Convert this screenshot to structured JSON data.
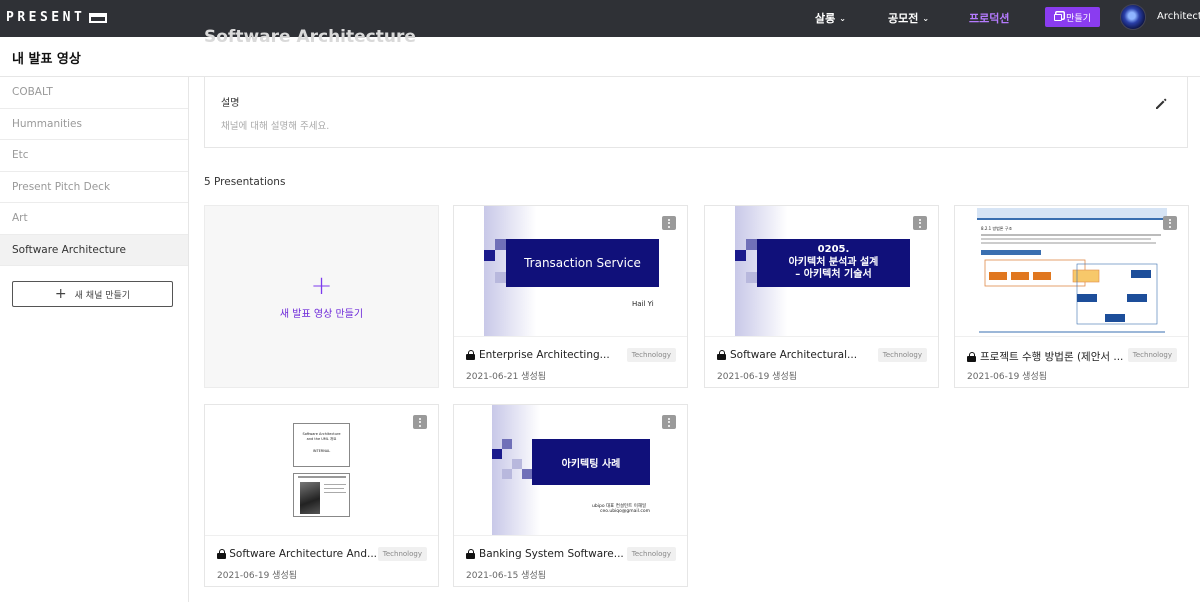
{
  "topbar": {
    "logo": "PRESENT",
    "nav": [
      {
        "label": "살롱",
        "has_menu": true
      },
      {
        "label": "공모전",
        "has_menu": true
      },
      {
        "label": "프로덕션",
        "has_menu": false,
        "active": true
      }
    ],
    "make_button": "만들기",
    "username": "Architect",
    "accent_color": "#8a3cf0"
  },
  "page": {
    "title": "내 발표 영상",
    "ghost_title": "Software Architecture"
  },
  "sidebar": {
    "items": [
      {
        "label": "COBALT"
      },
      {
        "label": "Hummanities"
      },
      {
        "label": "Etc"
      },
      {
        "label": "Present Pitch Deck"
      },
      {
        "label": "Art"
      },
      {
        "label": "Software Architecture",
        "active": true
      }
    ],
    "new_channel_label": "새 채널 만들기"
  },
  "description": {
    "label": "설명",
    "placeholder": "채널에 대해 설명해 주세요."
  },
  "presentations": {
    "count_label": "5 Presentations",
    "new_label": "새 발표 영상 만들기",
    "cards": [
      {
        "title": "Enterprise Architecting...",
        "tag": "Technology",
        "date": "2021-06-21 생성됨",
        "slide_text": "Transaction Service",
        "slide_sub": "Hail Yi"
      },
      {
        "title": "Software Architectural...",
        "tag": "Technology",
        "date": "2021-06-19 생성됨",
        "slide_text": "0205.\n아키텍처 분석과 설계\n– 아키텍처 기술서"
      },
      {
        "title": "프로젝트 수행 방법론 (제안서 ...",
        "tag": "Technology",
        "date": "2021-06-19 생성됨",
        "slide_heading": "8.2.1 방법론 구조"
      },
      {
        "title": "Software Architecture And...",
        "tag": "Technology",
        "date": "2021-06-19 생성됨",
        "slide_text": "Software Architecture and the UML 개요",
        "slide_sub": "INTERNAL"
      },
      {
        "title": "Banking System Software...",
        "tag": "Technology",
        "date": "2021-06-15 생성됨",
        "slide_text": "아키텍팅 사례",
        "slide_sub": "ubipo 대표 컨설턴트 이해일",
        "slide_sub2": "ceo.ubiqo@gmail.com"
      }
    ]
  }
}
